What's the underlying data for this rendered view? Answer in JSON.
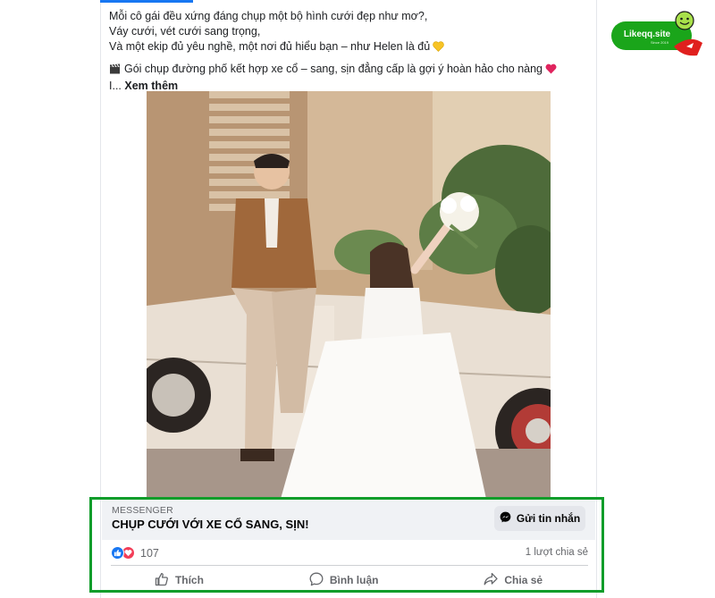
{
  "post": {
    "caption_lines": [
      "Mỗi cô gái đều xứng đáng chụp một bộ hình cưới đẹp như mơ?,",
      " Váy cưới, vét cưới sang trọng,",
      " Và một ekip đủ yêu nghề, một nơi đủ hiểu bạn – như Helen là đủ",
      "Gói chụp đường phố kết hợp xe cổ – sang, sịn đẳng cấp là gợi ý hoàn hảo cho nàng",
      "I..."
    ],
    "see_more": "Xem thêm",
    "emoji": {
      "line3": "yellow-heart-icon",
      "line4_start": "clapper-board-icon",
      "line4_end": "red-heart-icon"
    },
    "photo_alt": "wedding-couple-with-vintage-car"
  },
  "messenger_cta": {
    "label": "MESSENGER",
    "title": "CHỤP CƯỚI VỚI XE CỔ SANG, SỊN!",
    "button_label": "Gửi tin nhắn",
    "button_icon": "messenger-icon",
    "highlight_color": "#0f9d2a"
  },
  "stats": {
    "reaction_count": "107",
    "reaction_icons": [
      "like-icon",
      "love-icon"
    ],
    "share_count": "1 lượt chia sẻ"
  },
  "actions": [
    {
      "label": "Thích",
      "icon": "thumbs-up-icon"
    },
    {
      "label": "Bình luận",
      "icon": "comment-icon"
    },
    {
      "label": "Chia sẻ",
      "icon": "share-icon"
    }
  ],
  "watermark": {
    "text": "Likeqq.site",
    "subtext": "Since 2019",
    "bg_color": "#1aa51a"
  },
  "colors": {
    "accent": "#1877f2",
    "love": "#f33e58",
    "muted_text": "#65676b"
  }
}
